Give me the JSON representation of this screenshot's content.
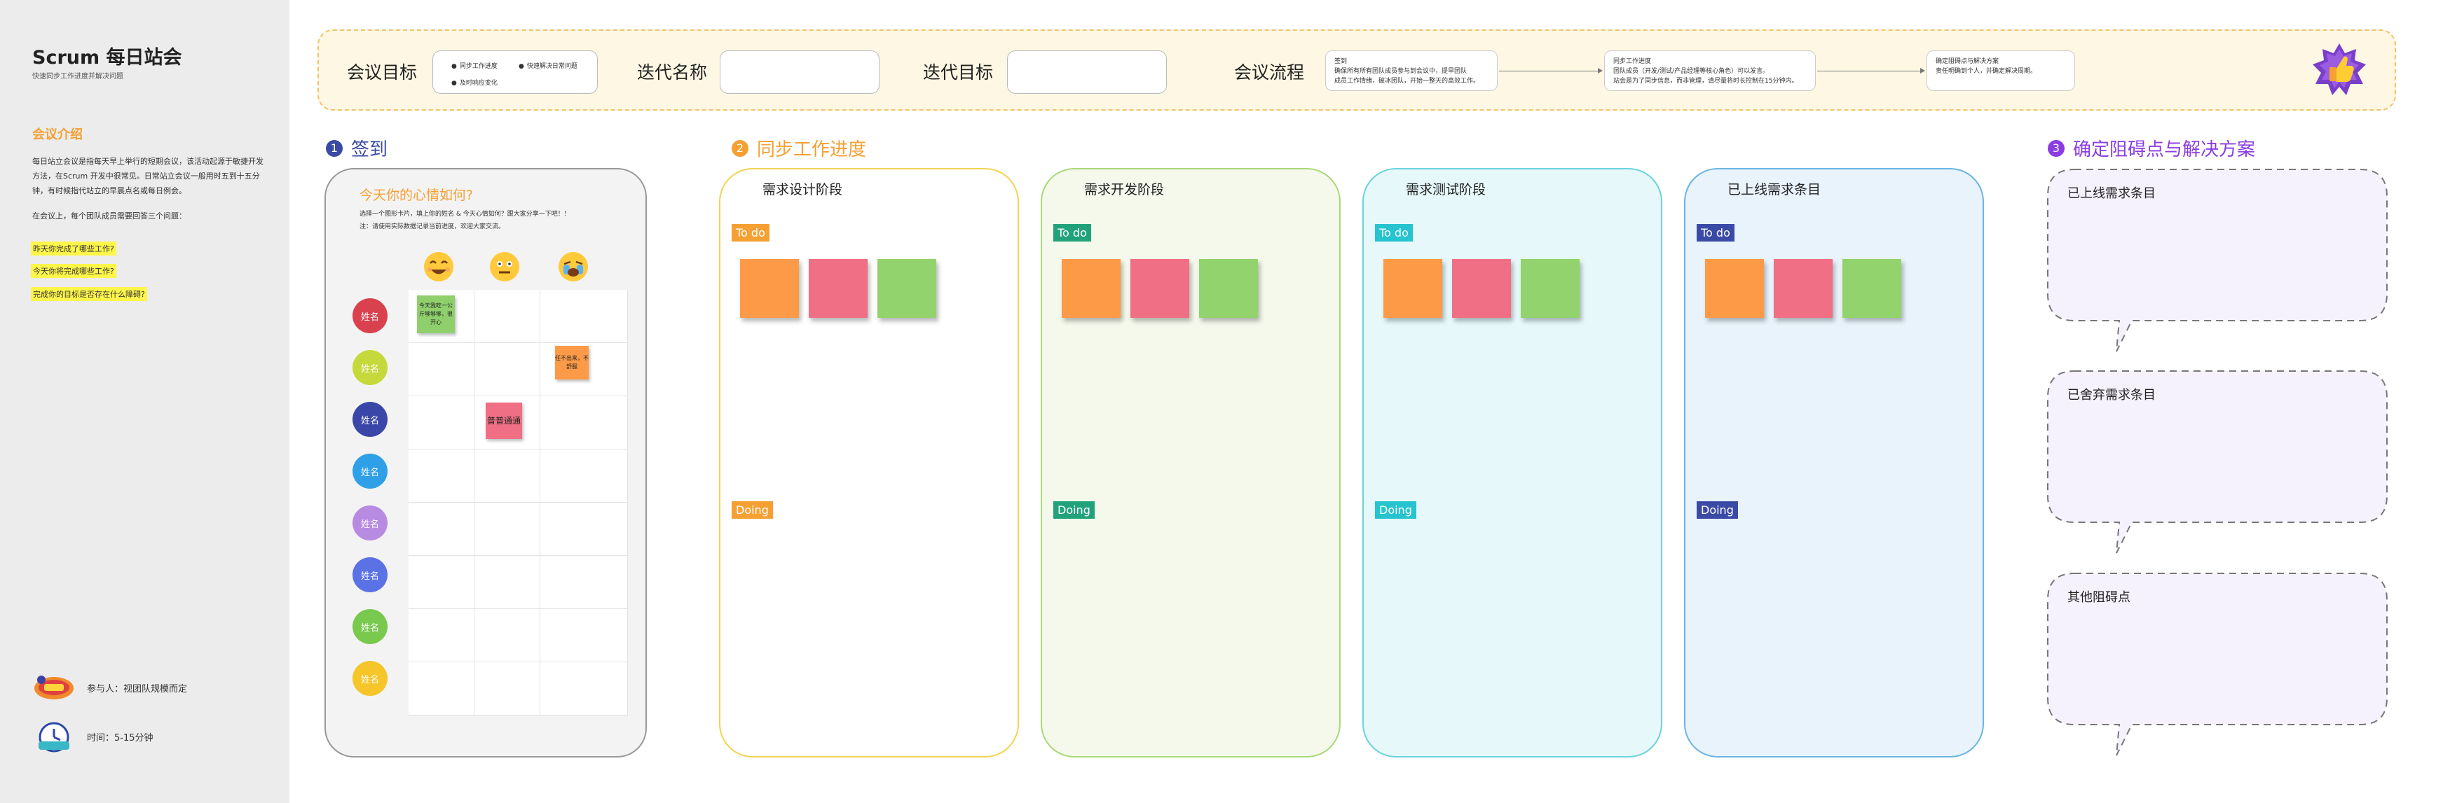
{
  "sidebar": {
    "title": "Scrum 每日站会",
    "subtitle": "快速同步工作进度并解决问题",
    "intro_heading": "会议介绍",
    "intro_text_1": "每日站立会议是指每天早上举行的短期会议，该活动起源于敏捷开发方法，在Scrum 开发中很常见。日常站立会议一般用时五到十五分钟，有时候指代站立的早晨点名或每日例会。",
    "intro_text_2": "在会议上，每个团队成员需要回答三个问题：",
    "questions": [
      "昨天你完成了哪些工作?",
      "今天你将完成哪些工作?",
      "完成你的目标是否存在什么障碍?"
    ],
    "participants": "参与人：视团队规模而定",
    "duration": "时间：5-15分钟",
    "colors": {
      "accent": "#f5a033",
      "highlight": "#fff64a"
    }
  },
  "banner": {
    "goal_label": "会议目标",
    "goal_items": [
      "同步工作进度",
      "快速解决日常问题",
      "及时响应变化"
    ],
    "iteration_name_label": "迭代名称",
    "iteration_goal_label": "迭代目标",
    "flow_label": "会议流程",
    "flow_steps": [
      {
        "title": "签到",
        "text_1": "确保所有所有团队成员参与到会议中，提早团队",
        "text_2": "成员工作情绪，破冰团队，开始一整天的高效工作。"
      },
      {
        "title": "同步工作进度",
        "text_1": "团队成员（开发/测试/产品经理等核心角色）可以发言。",
        "text_2": "站会是为了同步信息，而非管理，请尽量将时长控制在15分钟内。"
      },
      {
        "title": "确定阻碍点与解决方案",
        "text_1": "责任明确到个人，并确定解决周期。",
        "text_2": ""
      }
    ]
  },
  "checkin": {
    "section_number": "1",
    "section_title": "签到",
    "question": "今天你的心情如何?",
    "instruction_1": "选择一个图形卡片，填上你的姓名 & 今天心情如何？跟大家分享一下吧！！",
    "instruction_2": "注：请使用实际数据记录当前进度，欢迎大家交流。",
    "faces": [
      "happy-face-icon",
      "neutral-face-icon",
      "crying-face-icon"
    ],
    "members": [
      {
        "name": "姓名",
        "color": "#d9414f"
      },
      {
        "name": "姓名",
        "color": "#c5d93a"
      },
      {
        "name": "姓名",
        "color": "#3a46a8"
      },
      {
        "name": "姓名",
        "color": "#2fa0e8"
      },
      {
        "name": "姓名",
        "color": "#b88be3"
      },
      {
        "name": "姓名",
        "color": "#5a72e6"
      },
      {
        "name": "姓名",
        "color": "#78c94e"
      },
      {
        "name": "姓名",
        "color": "#f6c52a"
      }
    ],
    "notes": [
      {
        "text": "今天我吃一公斤够够够，很开心",
        "color": "#8fd06c"
      },
      {
        "text": "普普通通",
        "color": "#f06f84"
      },
      {
        "text": "任不出来，不舒服",
        "color": "#fd9a48"
      }
    ]
  },
  "progress": {
    "section_number": "2",
    "section_title": "同步工作进度",
    "todo_label": "To do",
    "doing_label": "Doing",
    "columns": [
      {
        "title": "需求设计阶段",
        "border": "#f3d452",
        "bg": "#ffffff",
        "tag": "#f5a033"
      },
      {
        "title": "需求开发阶段",
        "border": "#a9d978",
        "bg": "#f4f9ec",
        "tag": "#21a27a"
      },
      {
        "title": "需求测试阶段",
        "border": "#6cd3da",
        "bg": "#e6f8fa",
        "tag": "#25c4cf"
      },
      {
        "title": "已上线需求条目",
        "border": "#6bb5e2",
        "bg": "#e8f3fb",
        "tag": "#3a4aa5"
      }
    ],
    "sticky_colors": [
      "#fd9a48",
      "#f06f84",
      "#93d36d"
    ]
  },
  "blockers": {
    "section_number": "3",
    "section_title": "确定阻碍点与解决方案",
    "items": [
      "已上线需求条目",
      "已舍弃需求条目",
      "其他阻碍点"
    ],
    "color": "#8b3de2"
  }
}
